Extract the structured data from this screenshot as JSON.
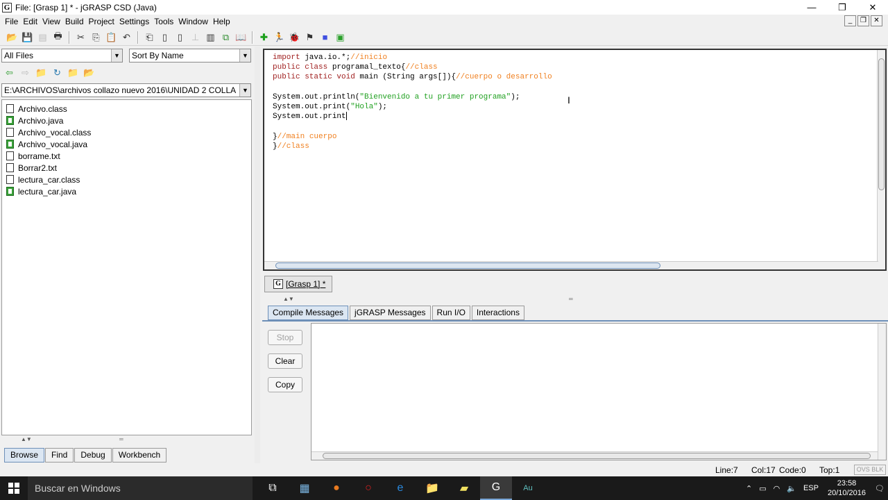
{
  "window": {
    "title": "File: [Grasp 1] * - jGRASP CSD (Java)",
    "logo": "G",
    "minimize": "—",
    "restore": "❐",
    "close": "✕"
  },
  "menu": [
    "File",
    "Edit",
    "View",
    "Build",
    "Project",
    "Settings",
    "Tools",
    "Window",
    "Help"
  ],
  "browser": {
    "filter": "All Files",
    "sort": "Sort By Name",
    "path": "E:\\ARCHIVOS\\archivos collazo nuevo 2016\\UNIDAD 2 COLLA",
    "files": [
      {
        "name": "Archivo.class",
        "type": "class"
      },
      {
        "name": "Archivo.java",
        "type": "java"
      },
      {
        "name": "Archivo_vocal.class",
        "type": "class"
      },
      {
        "name": "Archivo_vocal.java",
        "type": "java"
      },
      {
        "name": "borrame.txt",
        "type": "txt"
      },
      {
        "name": "Borrar2.txt",
        "type": "txt"
      },
      {
        "name": "lectura_car.class",
        "type": "class"
      },
      {
        "name": "lectura_car.java",
        "type": "java"
      }
    ],
    "tabs": [
      "Browse",
      "Find",
      "Debug",
      "Workbench"
    ]
  },
  "editor": {
    "lines": [
      [
        {
          "t": "import",
          "c": "kw"
        },
        {
          "t": " java.io.*;"
        },
        {
          "t": "//inicio",
          "c": "cm"
        }
      ],
      [
        {
          "t": "public class",
          "c": "kw"
        },
        {
          "t": " programal_texto{"
        },
        {
          "t": "//class",
          "c": "cm"
        }
      ],
      [
        {
          "t": "public static void",
          "c": "kw"
        },
        {
          "t": " main (String args[]){"
        },
        {
          "t": "//cuerpo o desarrollo",
          "c": "cm"
        }
      ],
      [],
      [
        {
          "t": "System.out.println("
        },
        {
          "t": "\"Bienvenido a tu primer programa\"",
          "c": "str"
        },
        {
          "t": ");"
        }
      ],
      [
        {
          "t": "System.out.print("
        },
        {
          "t": "\"Hola\"",
          "c": "str"
        },
        {
          "t": ");"
        }
      ],
      [
        {
          "t": "System.out.print"
        },
        {
          "caret": true
        }
      ],
      [],
      [
        {
          "t": "}"
        },
        {
          "t": "//main cuerpo",
          "c": "cm"
        }
      ],
      [
        {
          "t": "}"
        },
        {
          "t": "//class",
          "c": "cm"
        }
      ]
    ]
  },
  "doc_tab": {
    "icon": "G",
    "label": "[Grasp 1] *"
  },
  "messages": {
    "tabs": [
      "Compile Messages",
      "jGRASP Messages",
      "Run I/O",
      "Interactions"
    ],
    "stop": "Stop",
    "clear": "Clear",
    "copy": "Copy"
  },
  "status": {
    "line": "Line:7",
    "col": "Col:17",
    "code": "Code:0",
    "top": "Top:1",
    "mode": "OVS BLK"
  },
  "taskbar": {
    "search_placeholder": "Buscar en Windows",
    "lang": "ESP",
    "time": "23:58",
    "date": "20/10/2016"
  }
}
